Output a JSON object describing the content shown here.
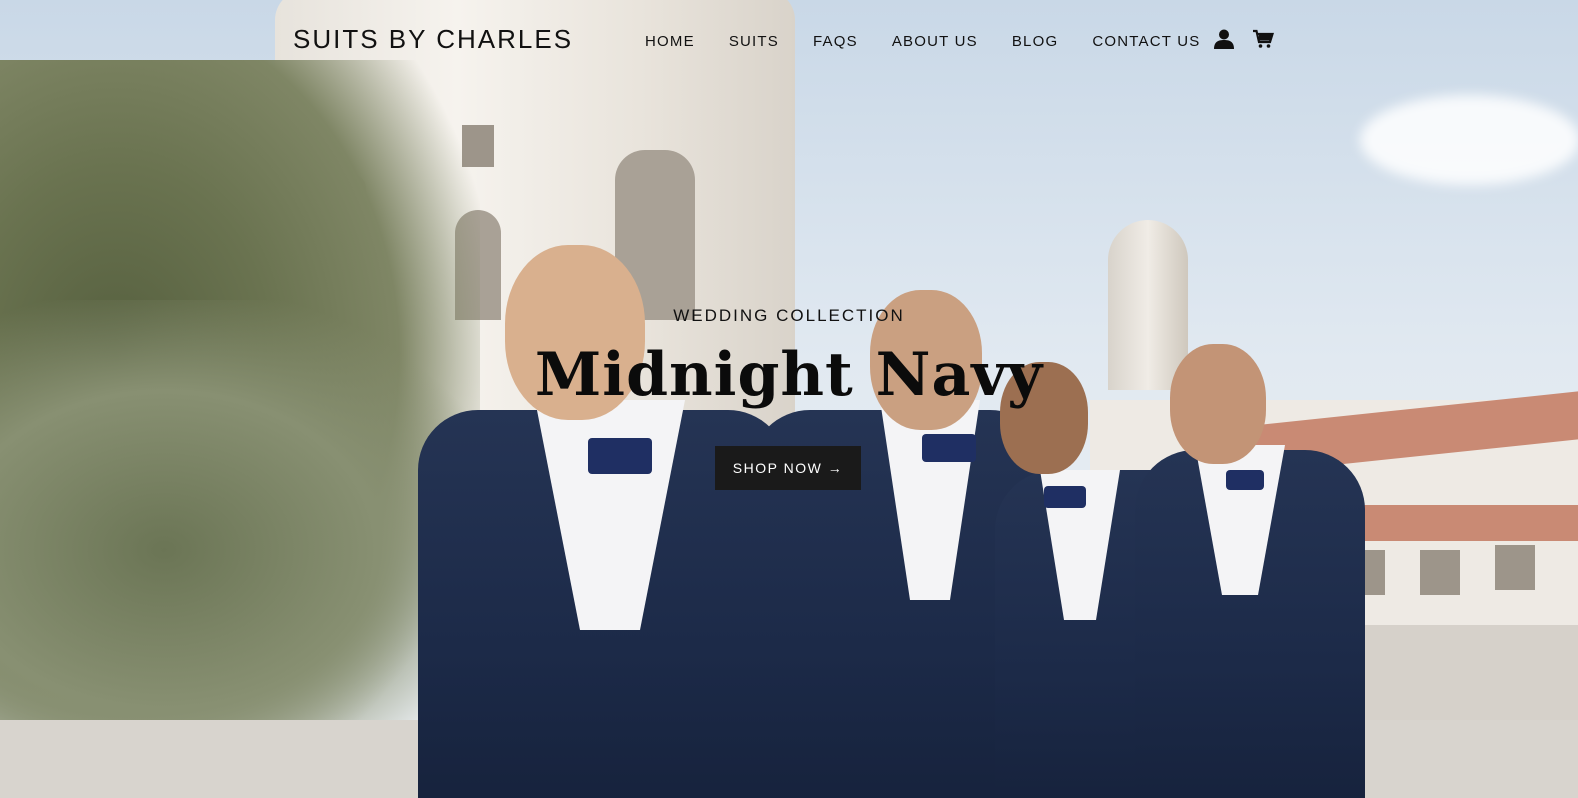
{
  "header": {
    "logo": "SUITS BY CHARLES",
    "nav": [
      "HOME",
      "SUITS",
      "FAQS",
      "ABOUT US",
      "BLOG",
      "CONTACT US"
    ],
    "icons": [
      "account-icon",
      "cart-icon"
    ]
  },
  "hero": {
    "eyebrow": "WEDDING COLLECTION",
    "title": "Midnight Navy",
    "cta_label": "SHOP NOW →"
  },
  "colors": {
    "text": "#111111",
    "button_bg": "#1a1a1a",
    "button_text": "#ffffff",
    "suit_navy": "#1c2a48"
  }
}
